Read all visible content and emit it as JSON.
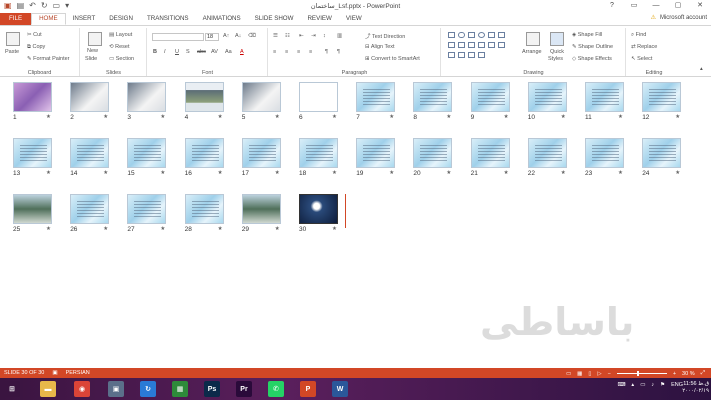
{
  "window": {
    "title": "ساختمان_Lsf.pptx - PowerPoint",
    "controls": [
      "?",
      "▭",
      "—",
      "▢",
      "✕"
    ]
  },
  "tabs": [
    "FILE",
    "HOME",
    "INSERT",
    "DESIGN",
    "TRANSITIONS",
    "ANIMATIONS",
    "SLIDE SHOW",
    "REVIEW",
    "VIEW"
  ],
  "account": {
    "label": "Microsoft account",
    "warning_icon": "warning-icon"
  },
  "ribbon": {
    "clipboard": {
      "label": "Clipboard",
      "paste": "Paste",
      "cut": "Cut",
      "copy": "Copy",
      "format_painter": "Format Painter"
    },
    "slides": {
      "label": "Slides",
      "new_slide_line1": "New",
      "new_slide_line2": "Slide",
      "layout": "Layout",
      "reset": "Reset",
      "section": "Section"
    },
    "font": {
      "label": "Font",
      "font_name": "",
      "font_size": "18",
      "bold": "B",
      "italic": "I",
      "underline": "U",
      "shadow": "S",
      "strike": "abc",
      "spacing": "AV",
      "case": "Aa",
      "color": "A"
    },
    "paragraph": {
      "label": "Paragraph",
      "text_direction": "Text Direction",
      "align_text": "Align Text",
      "convert_smartart": "Convert to SmartArt"
    },
    "drawing": {
      "label": "Drawing",
      "arrange": "Arrange",
      "quick_styles_line1": "Quick",
      "quick_styles_line2": "Styles",
      "shape_fill": "Shape Fill",
      "shape_outline": "Shape Outline",
      "shape_effects": "Shape Effects"
    },
    "editing": {
      "label": "Editing",
      "find": "Find",
      "replace": "Replace",
      "select": "Select"
    }
  },
  "slides": [
    {
      "n": "1",
      "style": "t-purple"
    },
    {
      "n": "2",
      "style": "t-gray"
    },
    {
      "n": "3",
      "style": "t-gray"
    },
    {
      "n": "4",
      "style": "t-photo"
    },
    {
      "n": "5",
      "style": "t-gray"
    },
    {
      "n": "6",
      "style": "t-doc"
    },
    {
      "n": "7",
      "style": ""
    },
    {
      "n": "8",
      "style": ""
    },
    {
      "n": "9",
      "style": ""
    },
    {
      "n": "10",
      "style": ""
    },
    {
      "n": "11",
      "style": ""
    },
    {
      "n": "12",
      "style": ""
    },
    {
      "n": "13",
      "style": ""
    },
    {
      "n": "14",
      "style": ""
    },
    {
      "n": "15",
      "style": ""
    },
    {
      "n": "16",
      "style": ""
    },
    {
      "n": "17",
      "style": ""
    },
    {
      "n": "18",
      "style": ""
    },
    {
      "n": "19",
      "style": ""
    },
    {
      "n": "20",
      "style": ""
    },
    {
      "n": "21",
      "style": ""
    },
    {
      "n": "22",
      "style": ""
    },
    {
      "n": "23",
      "style": ""
    },
    {
      "n": "24",
      "style": ""
    },
    {
      "n": "25",
      "style": "t-green"
    },
    {
      "n": "26",
      "style": ""
    },
    {
      "n": "27",
      "style": ""
    },
    {
      "n": "28",
      "style": ""
    },
    {
      "n": "29",
      "style": "t-green"
    },
    {
      "n": "30",
      "style": "t-dark"
    }
  ],
  "star_glyph": "★",
  "watermark": "باساطی",
  "status": {
    "slide_counter": "SLIDE 30 OF 30",
    "language": "PERSIAN",
    "zoom": "30 %"
  },
  "taskbar": {
    "apps": [
      {
        "name": "windows-start-icon",
        "glyph": "⊞",
        "color": "#3a1440"
      },
      {
        "name": "file-explorer-icon",
        "glyph": "▬",
        "color": "#e8b84a"
      },
      {
        "name": "chrome-icon",
        "glyph": "◉",
        "color": "#db4437"
      },
      {
        "name": "network-icon",
        "glyph": "▣",
        "color": "#5b6f8a"
      },
      {
        "name": "sync-icon",
        "glyph": "↻",
        "color": "#2a7ad6"
      },
      {
        "name": "calculator-icon",
        "glyph": "▦",
        "color": "#2e8b3a"
      },
      {
        "name": "photoshop-icon",
        "glyph": "Ps",
        "color": "#0b2a4a"
      },
      {
        "name": "premiere-icon",
        "glyph": "Pr",
        "color": "#2a0a3a"
      },
      {
        "name": "whatsapp-icon",
        "glyph": "✆",
        "color": "#25d366"
      },
      {
        "name": "powerpoint-icon",
        "glyph": "P",
        "color": "#d24726"
      },
      {
        "name": "word-icon",
        "glyph": "W",
        "color": "#2b579a"
      }
    ],
    "tray_lang": "ENG",
    "time": "11:56 ق.ظ",
    "date": "۲۰۰۰/۰۲/۱۹"
  }
}
